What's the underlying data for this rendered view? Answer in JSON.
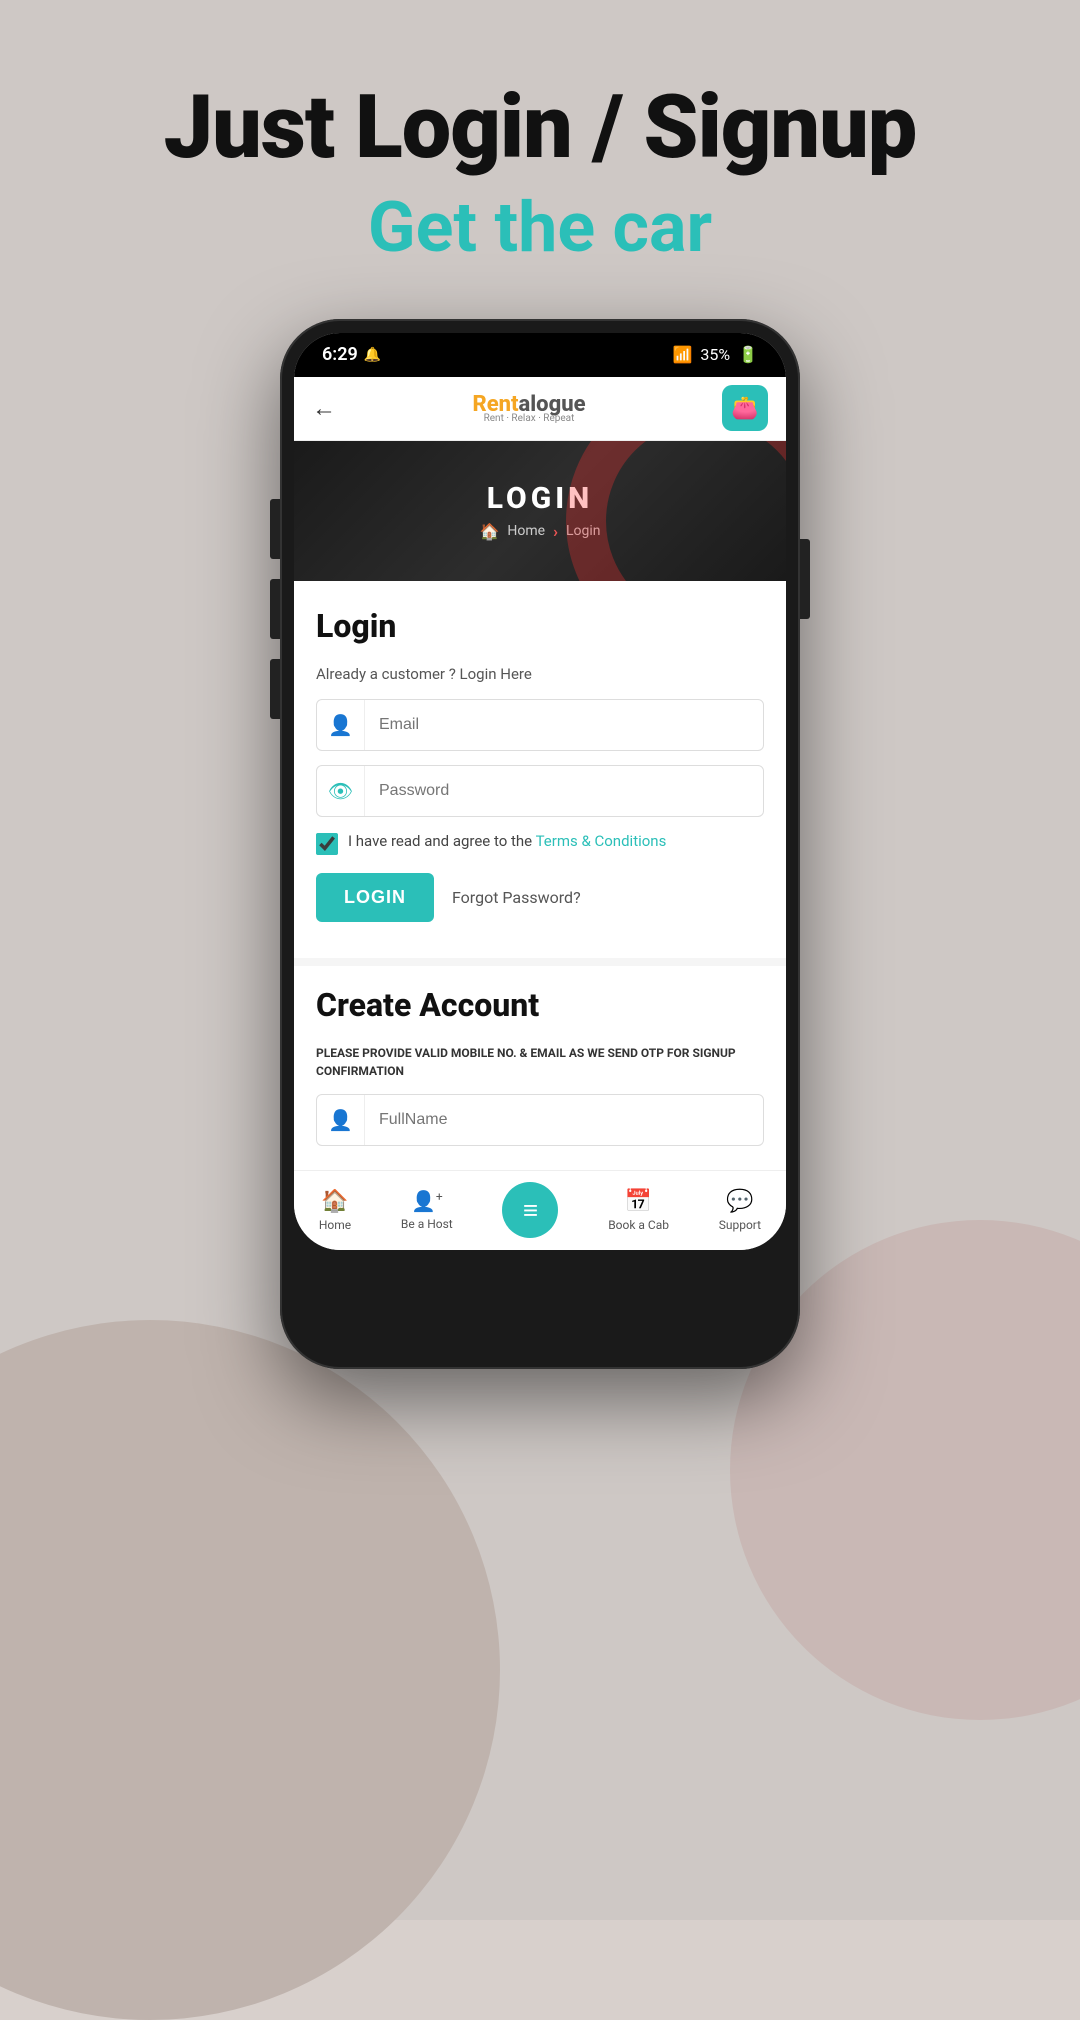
{
  "page": {
    "background_color": "#cec8c5"
  },
  "hero": {
    "title": "Just Login / Signup",
    "subtitle": "Get the car"
  },
  "status_bar": {
    "time": "6:29",
    "battery": "35%",
    "signal": "●●●"
  },
  "app_header": {
    "back_label": "←",
    "logo_part1": "R",
    "logo_brand": "entalogue",
    "logo_tagline": "Rent · Relax · Repeat",
    "wallet_icon": "💼"
  },
  "banner": {
    "title": "LOGIN",
    "breadcrumb_home": "Home",
    "breadcrumb_sep": "›",
    "breadcrumb_current": "Login"
  },
  "login_form": {
    "section_title": "Login",
    "subtitle": "Already a customer ? Login Here",
    "email_placeholder": "Email",
    "password_placeholder": "Password",
    "terms_prefix": "I have read and agree to the ",
    "terms_link": "Terms & Conditions",
    "login_button": "LOGIN",
    "forgot_password": "Forgot Password?"
  },
  "create_account": {
    "section_title": "Create Account",
    "otp_notice": "PLEASE PROVIDE VALID MOBILE NO. & EMAIL AS WE SEND OTP FOR SIGNUP CONFIRMATION",
    "fullname_placeholder": "FullName"
  },
  "bottom_nav": {
    "items": [
      {
        "label": "Home",
        "icon": "🏠"
      },
      {
        "label": "Be a Host",
        "icon": "👤+"
      },
      {
        "label": "",
        "icon": "≡",
        "is_center": true
      },
      {
        "label": "Book a Cab",
        "icon": "📅"
      },
      {
        "label": "Support",
        "icon": "💬"
      }
    ]
  }
}
